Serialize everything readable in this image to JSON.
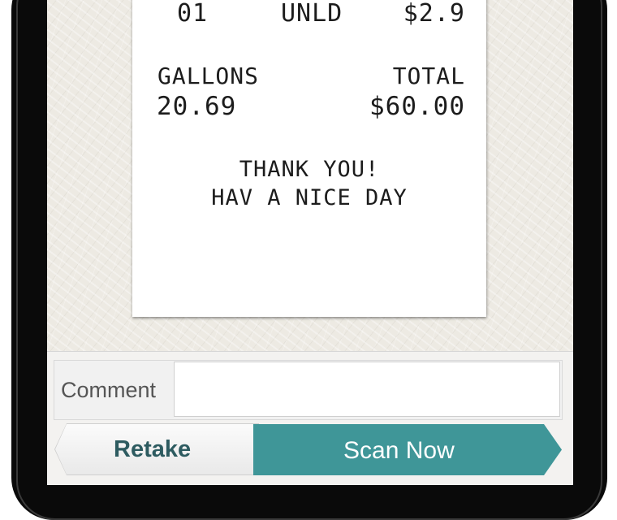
{
  "receipt": {
    "pump": "01",
    "grade": "UNLD",
    "price": "$2.9",
    "gallons_label": "GALLONS",
    "total_label": "TOTAL",
    "gallons_value": "20.69",
    "total_value": "$60.00",
    "thanks_line": "THANK YOU!",
    "nice_day_line": "HAV A NICE DAY"
  },
  "comment": {
    "label": "Comment",
    "value": "",
    "placeholder": ""
  },
  "actions": {
    "retake_label": "Retake",
    "scan_label": "Scan Now"
  },
  "colors": {
    "scan_button": "#3f9698",
    "retake_text": "#2d5b60",
    "phone_frame": "#0a0a0a"
  }
}
